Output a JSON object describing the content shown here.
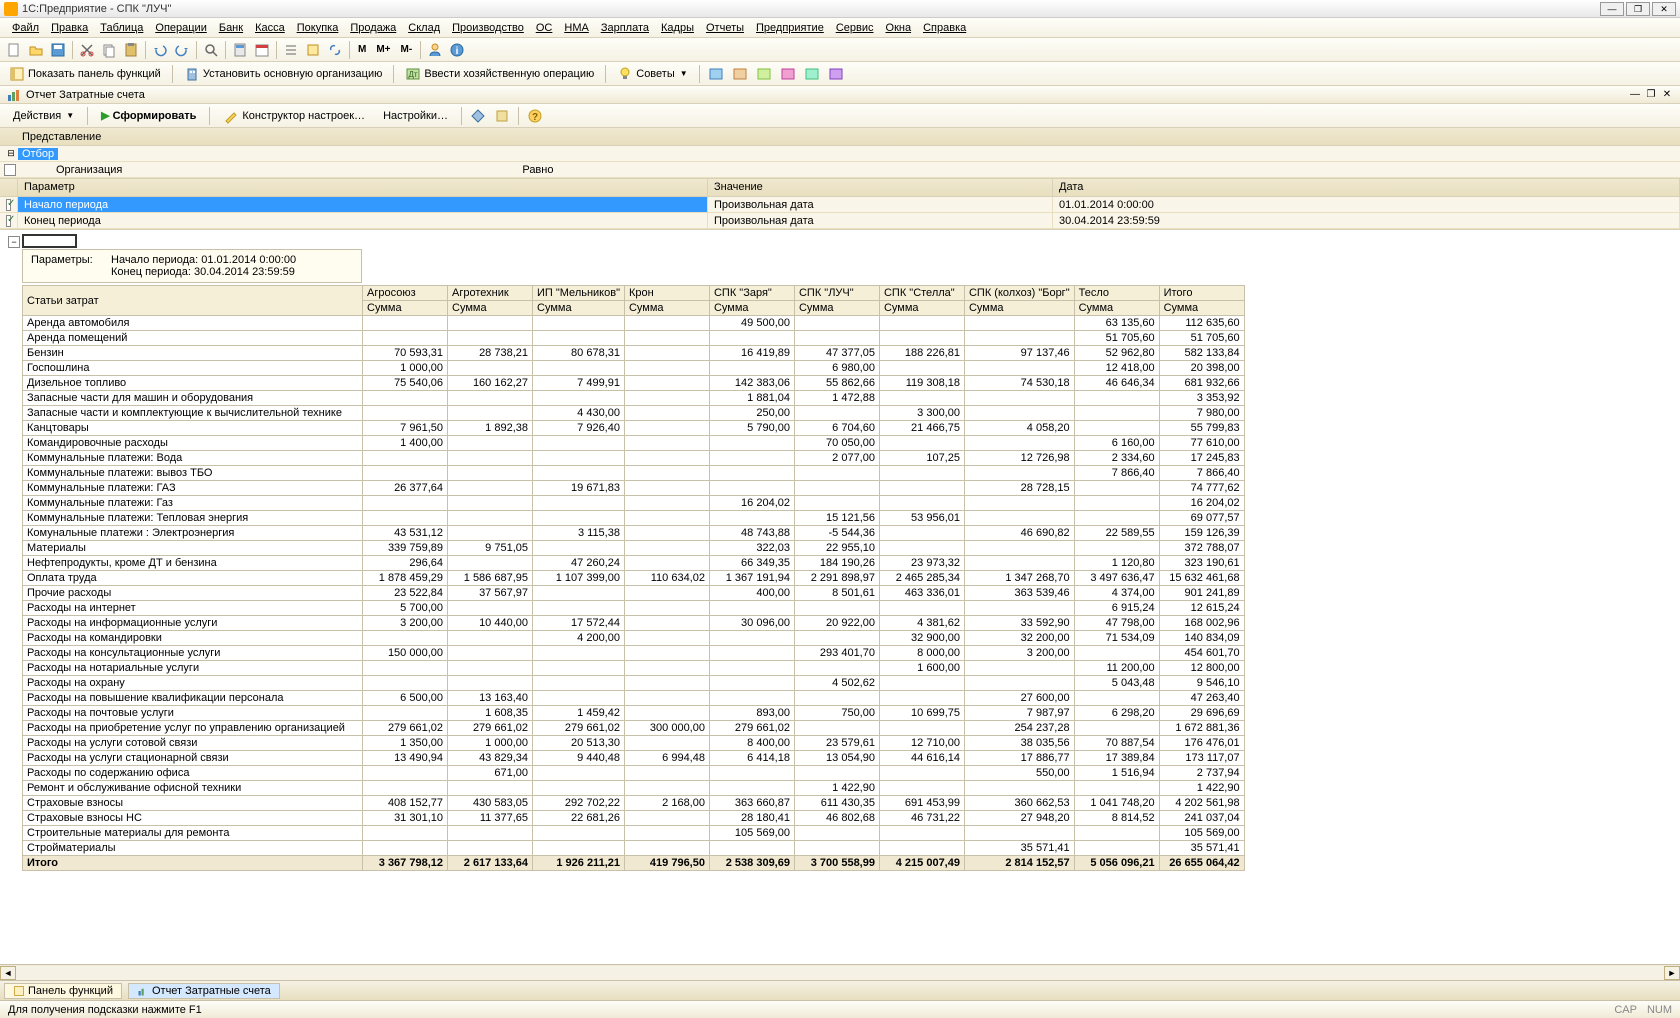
{
  "window_title": "1С:Предприятие - СПК \"ЛУЧ\"",
  "menu": [
    "Файл",
    "Правка",
    "Таблица",
    "Операции",
    "Банк",
    "Касса",
    "Покупка",
    "Продажа",
    "Склад",
    "Производство",
    "ОС",
    "НМА",
    "Зарплата",
    "Кадры",
    "Отчеты",
    "Предприятие",
    "Сервис",
    "Окна",
    "Справка"
  ],
  "toolbar_mm": [
    "M",
    "M+",
    "M-"
  ],
  "toolbar2": {
    "show_panel": "Показать панель функций",
    "set_main_org": "Установить основную организацию",
    "enter_op": "Ввести хозяйственную операцию",
    "tips": "Советы"
  },
  "doc_title": "Отчет  Затратные счета",
  "actions": {
    "actions": "Действия",
    "generate": "Сформировать",
    "constructor": "Конструктор настроек…",
    "settings": "Настройки…"
  },
  "filter": {
    "header": "Представление",
    "otbor": "Отбор",
    "org": "Организация",
    "ravno": "Равно"
  },
  "params_grid": {
    "hdr_param": "Параметр",
    "hdr_value": "Значение",
    "hdr_date": "Дата",
    "start_label": "Начало периода",
    "end_label": "Конец периода",
    "value_text": "Произвольная дата",
    "start_date": "01.01.2014 0:00:00",
    "end_date": "30.04.2014 23:59:59"
  },
  "report_params": {
    "title": "Параметры:",
    "line1_lbl": "Начало периода:",
    "line1_val": "01.01.2014 0:00:00",
    "line2_lbl": "Конец периода:",
    "line2_val": "30.04.2014 23:59:59"
  },
  "columns_top": [
    "Статьи затрат",
    "Агросоюз",
    "Агротехник",
    "ИП \"Мельников\"",
    "Крон",
    "СПК \"Заря\"",
    "СПК \"ЛУЧ\"",
    "СПК \"Стелла\"",
    "СПК (колхоз) \"Борг\"",
    "Тесло",
    "Итого"
  ],
  "columns_sub": "Сумма",
  "rows": [
    {
      "n": "Аренда автомобиля",
      "v": [
        "",
        "",
        "",
        "",
        "49 500,00",
        "",
        "",
        "",
        "63 135,60",
        "112 635,60"
      ]
    },
    {
      "n": "Аренда помещений",
      "v": [
        "",
        "",
        "",
        "",
        "",
        "",
        "",
        "",
        "51 705,60",
        "51 705,60"
      ]
    },
    {
      "n": "Бензин",
      "v": [
        "70 593,31",
        "28 738,21",
        "80 678,31",
        "",
        "16 419,89",
        "47 377,05",
        "188 226,81",
        "97 137,46",
        "52 962,80",
        "582 133,84"
      ]
    },
    {
      "n": "Госпошлина",
      "v": [
        "1 000,00",
        "",
        "",
        "",
        "",
        "6 980,00",
        "",
        "",
        "12 418,00",
        "20 398,00"
      ]
    },
    {
      "n": "Дизельное топливо",
      "v": [
        "75 540,06",
        "160 162,27",
        "7 499,91",
        "",
        "142 383,06",
        "55 862,66",
        "119 308,18",
        "74 530,18",
        "46 646,34",
        "681 932,66"
      ]
    },
    {
      "n": "Запасные части для машин и оборудования",
      "v": [
        "",
        "",
        "",
        "",
        "1 881,04",
        "1 472,88",
        "",
        "",
        "",
        "3 353,92"
      ]
    },
    {
      "n": "Запасные части и комплектующие к вычислительной технике",
      "v": [
        "",
        "",
        "4 430,00",
        "",
        "250,00",
        "",
        "3 300,00",
        "",
        "",
        "7 980,00"
      ]
    },
    {
      "n": "Канцтовары",
      "v": [
        "7 961,50",
        "1 892,38",
        "7 926,40",
        "",
        "5 790,00",
        "6 704,60",
        "21 466,75",
        "4 058,20",
        "",
        "55 799,83"
      ]
    },
    {
      "n": "Командировочные расходы",
      "v": [
        "1 400,00",
        "",
        "",
        "",
        "",
        "70 050,00",
        "",
        "",
        "6 160,00",
        "77 610,00"
      ]
    },
    {
      "n": "Коммунальные платежи: Вода",
      "v": [
        "",
        "",
        "",
        "",
        "",
        "2 077,00",
        "107,25",
        "12 726,98",
        "2 334,60",
        "17 245,83"
      ]
    },
    {
      "n": "Коммунальные платежи: вывоз ТБО",
      "v": [
        "",
        "",
        "",
        "",
        "",
        "",
        "",
        "",
        "7 866,40",
        "7 866,40"
      ]
    },
    {
      "n": "Коммунальные платежи: ГАЗ",
      "v": [
        "26 377,64",
        "",
        "19 671,83",
        "",
        "",
        "",
        "",
        "28 728,15",
        "",
        "74 777,62"
      ]
    },
    {
      "n": "Коммунальные платежи: Газ",
      "v": [
        "",
        "",
        "",
        "",
        "16 204,02",
        "",
        "",
        "",
        "",
        "16 204,02"
      ]
    },
    {
      "n": "Коммунальные платежи: Тепловая энергия",
      "v": [
        "",
        "",
        "",
        "",
        "",
        "15 121,56",
        "53 956,01",
        "",
        "",
        "69 077,57"
      ]
    },
    {
      "n": "Комунальные платежи : Электроэнергия",
      "v": [
        "43 531,12",
        "",
        "3 115,38",
        "",
        "48 743,88",
        "-5 544,36",
        "",
        "46 690,82",
        "22 589,55",
        "159 126,39"
      ]
    },
    {
      "n": "Материалы",
      "v": [
        "339 759,89",
        "9 751,05",
        "",
        "",
        "322,03",
        "22 955,10",
        "",
        "",
        "",
        "372 788,07"
      ]
    },
    {
      "n": "Нефтепродукты, кроме ДТ и бензина",
      "v": [
        "296,64",
        "",
        "47 260,24",
        "",
        "66 349,35",
        "184 190,26",
        "23 973,32",
        "",
        "1 120,80",
        "323 190,61"
      ]
    },
    {
      "n": "Оплата труда",
      "v": [
        "1 878 459,29",
        "1 586 687,95",
        "1 107 399,00",
        "110 634,02",
        "1 367 191,94",
        "2 291 898,97",
        "2 465 285,34",
        "1 347 268,70",
        "3 497 636,47",
        "15 632 461,68"
      ]
    },
    {
      "n": "Прочие расходы",
      "v": [
        "23 522,84",
        "37 567,97",
        "",
        "",
        "400,00",
        "8 501,61",
        "463 336,01",
        "363 539,46",
        "4 374,00",
        "901 241,89"
      ]
    },
    {
      "n": "Расходы на интернет",
      "v": [
        "5 700,00",
        "",
        "",
        "",
        "",
        "",
        "",
        "",
        "6 915,24",
        "12 615,24"
      ]
    },
    {
      "n": "Расходы на информационные услуги",
      "v": [
        "3 200,00",
        "10 440,00",
        "17 572,44",
        "",
        "30 096,00",
        "20 922,00",
        "4 381,62",
        "33 592,90",
        "47 798,00",
        "168 002,96"
      ]
    },
    {
      "n": "Расходы на командировки",
      "v": [
        "",
        "",
        "4 200,00",
        "",
        "",
        "",
        "32 900,00",
        "32 200,00",
        "71 534,09",
        "140 834,09"
      ]
    },
    {
      "n": "Расходы на консультационные услуги",
      "v": [
        "150 000,00",
        "",
        "",
        "",
        "",
        "293 401,70",
        "8 000,00",
        "3 200,00",
        "",
        "454 601,70"
      ]
    },
    {
      "n": "Расходы на нотариальные услуги",
      "v": [
        "",
        "",
        "",
        "",
        "",
        "",
        "1 600,00",
        "",
        "11 200,00",
        "12 800,00"
      ]
    },
    {
      "n": "Расходы на охрану",
      "v": [
        "",
        "",
        "",
        "",
        "",
        "4 502,62",
        "",
        "",
        "5 043,48",
        "9 546,10"
      ]
    },
    {
      "n": "Расходы на повышение квалификации персонала",
      "v": [
        "6 500,00",
        "13 163,40",
        "",
        "",
        "",
        "",
        "",
        "27 600,00",
        "",
        "47 263,40"
      ]
    },
    {
      "n": "Расходы на почтовые услуги",
      "v": [
        "",
        "1 608,35",
        "1 459,42",
        "",
        "893,00",
        "750,00",
        "10 699,75",
        "7 987,97",
        "6 298,20",
        "29 696,69"
      ]
    },
    {
      "n": "Расходы на приобретение услуг по управлению организацией",
      "v": [
        "279 661,02",
        "279 661,02",
        "279 661,02",
        "300 000,00",
        "279 661,02",
        "",
        "",
        "254 237,28",
        "",
        "1 672 881,36"
      ]
    },
    {
      "n": "Расходы на услуги сотовой связи",
      "v": [
        "1 350,00",
        "1 000,00",
        "20 513,30",
        "",
        "8 400,00",
        "23 579,61",
        "12 710,00",
        "38 035,56",
        "70 887,54",
        "176 476,01"
      ]
    },
    {
      "n": "Расходы на услуги стационарной связи",
      "v": [
        "13 490,94",
        "43 829,34",
        "9 440,48",
        "6 994,48",
        "6 414,18",
        "13 054,90",
        "44 616,14",
        "17 886,77",
        "17 389,84",
        "173 117,07"
      ]
    },
    {
      "n": "Расходы по содержанию офиса",
      "v": [
        "",
        "671,00",
        "",
        "",
        "",
        "",
        "",
        "550,00",
        "1 516,94",
        "2 737,94"
      ]
    },
    {
      "n": "Ремонт и обслуживание офисной  техники",
      "v": [
        "",
        "",
        "",
        "",
        "",
        "1 422,90",
        "",
        "",
        "",
        "1 422,90"
      ]
    },
    {
      "n": "Страховые взносы",
      "v": [
        "408 152,77",
        "430 583,05",
        "292 702,22",
        "2 168,00",
        "363 660,87",
        "611 430,35",
        "691 453,99",
        "360 662,53",
        "1 041 748,20",
        "4 202 561,98"
      ]
    },
    {
      "n": "Страховые взносы НС",
      "v": [
        "31 301,10",
        "11 377,65",
        "22 681,26",
        "",
        "28 180,41",
        "46 802,68",
        "46 731,22",
        "27 948,20",
        "8 814,52",
        "241 037,04"
      ]
    },
    {
      "n": "Строительные материалы для ремонта",
      "v": [
        "",
        "",
        "",
        "",
        "105 569,00",
        "",
        "",
        "",
        "",
        "105 569,00"
      ]
    },
    {
      "n": "Стройматериалы",
      "v": [
        "",
        "",
        "",
        "",
        "",
        "",
        "",
        "35 571,41",
        "",
        "35 571,41"
      ]
    }
  ],
  "total_row": {
    "n": "Итого",
    "v": [
      "3 367 798,12",
      "2 617 133,64",
      "1 926 211,21",
      "419 796,50",
      "2 538 309,69",
      "3 700 558,99",
      "4 215 007,49",
      "2 814 152,57",
      "5 056 096,21",
      "26 655 064,42"
    ]
  },
  "bottom_tabs": {
    "panel": "Панель функций",
    "report": "Отчет  Затратные счета"
  },
  "status_hint": "Для получения подсказки нажмите F1",
  "status_right": [
    "CAP",
    "NUM"
  ]
}
